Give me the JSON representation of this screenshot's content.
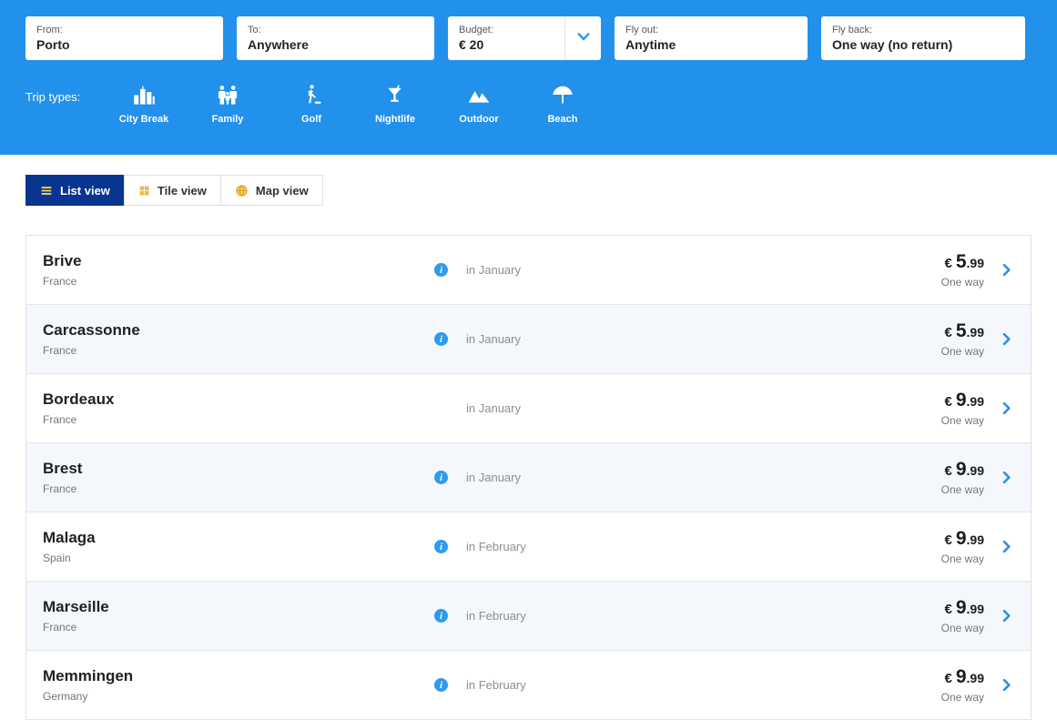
{
  "colors": {
    "header_blue": "#2191eb",
    "active_tab_navy": "#07358f",
    "accent_blue": "#2e9bef",
    "accent_yellow": "#f6b83d"
  },
  "search": {
    "fields": [
      {
        "label": "From:",
        "value": "Porto"
      },
      {
        "label": "To:",
        "value": "Anywhere"
      },
      {
        "label": "Budget:",
        "value": "€ 20",
        "has_dropdown": true
      },
      {
        "label": "Fly out:",
        "value": "Anytime"
      },
      {
        "label": "Fly back:",
        "value": "One way (no return)"
      }
    ],
    "trip_types_label": "Trip types:",
    "trip_types": [
      {
        "label": "City Break",
        "icon": "city-break-icon"
      },
      {
        "label": "Family",
        "icon": "family-icon"
      },
      {
        "label": "Golf",
        "icon": "golf-icon"
      },
      {
        "label": "Nightlife",
        "icon": "nightlife-icon"
      },
      {
        "label": "Outdoor",
        "icon": "outdoor-icon"
      },
      {
        "label": "Beach",
        "icon": "beach-icon"
      }
    ]
  },
  "view_tabs": [
    {
      "label": "List view",
      "icon": "list-view-icon",
      "active": true
    },
    {
      "label": "Tile view",
      "icon": "tile-view-icon",
      "active": false
    },
    {
      "label": "Map view",
      "icon": "map-view-icon",
      "active": false
    }
  ],
  "results": [
    {
      "city": "Brive",
      "country": "France",
      "has_info": true,
      "month": "in January",
      "currency": "€",
      "price_whole": "5",
      "price_decimal": ".99",
      "fare_type": "One way"
    },
    {
      "city": "Carcassonne",
      "country": "France",
      "has_info": true,
      "month": "in January",
      "currency": "€",
      "price_whole": "5",
      "price_decimal": ".99",
      "fare_type": "One way"
    },
    {
      "city": "Bordeaux",
      "country": "France",
      "has_info": false,
      "month": "in January",
      "currency": "€",
      "price_whole": "9",
      "price_decimal": ".99",
      "fare_type": "One way"
    },
    {
      "city": "Brest",
      "country": "France",
      "has_info": true,
      "month": "in January",
      "currency": "€",
      "price_whole": "9",
      "price_decimal": ".99",
      "fare_type": "One way"
    },
    {
      "city": "Malaga",
      "country": "Spain",
      "has_info": true,
      "month": "in February",
      "currency": "€",
      "price_whole": "9",
      "price_decimal": ".99",
      "fare_type": "One way"
    },
    {
      "city": "Marseille",
      "country": "France",
      "has_info": true,
      "month": "in February",
      "currency": "€",
      "price_whole": "9",
      "price_decimal": ".99",
      "fare_type": "One way"
    },
    {
      "city": "Memmingen",
      "country": "Germany",
      "has_info": true,
      "month": "in February",
      "currency": "€",
      "price_whole": "9",
      "price_decimal": ".99",
      "fare_type": "One way"
    }
  ]
}
